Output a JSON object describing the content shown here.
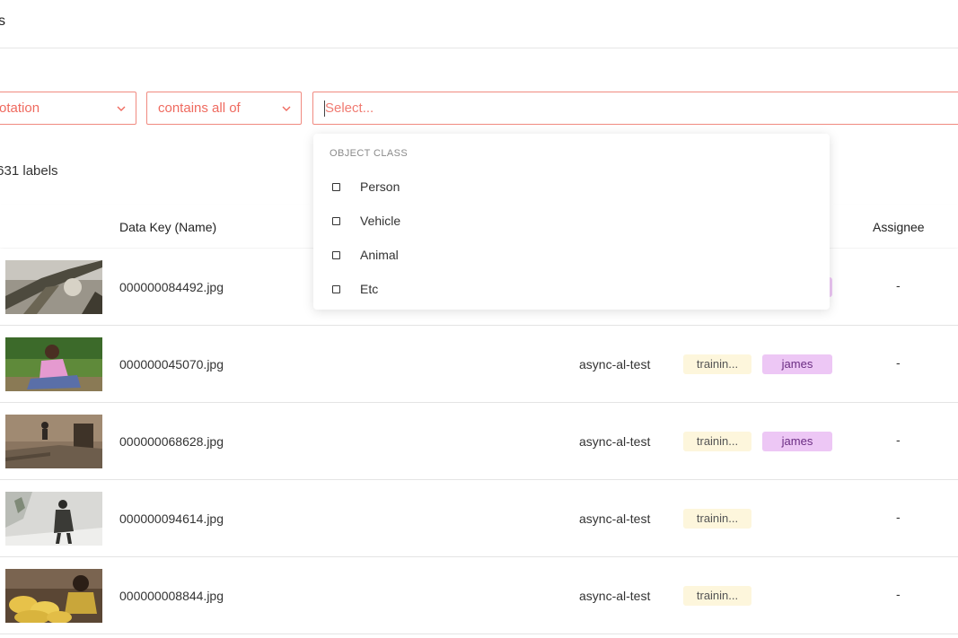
{
  "header": {
    "title": "s"
  },
  "filters": {
    "field": "otation",
    "operator": "contains all of",
    "value_placeholder": "Select..."
  },
  "summary": {
    "count": ",631 labels"
  },
  "table": {
    "headers": {
      "data_key": "Data Key (Name)",
      "assignee": "Assignee"
    },
    "rows": [
      {
        "key": "000000084492.jpg",
        "project": "",
        "tag": "",
        "user": "",
        "assignee": "-"
      },
      {
        "key": "000000045070.jpg",
        "project": "async-al-test",
        "tag": "trainin...",
        "user": "james",
        "assignee": "-"
      },
      {
        "key": "000000068628.jpg",
        "project": "async-al-test",
        "tag": "trainin...",
        "user": "james",
        "assignee": "-"
      },
      {
        "key": "000000094614.jpg",
        "project": "async-al-test",
        "tag": "trainin...",
        "user": "",
        "assignee": "-"
      },
      {
        "key": "000000008844.jpg",
        "project": "async-al-test",
        "tag": "trainin...",
        "user": "",
        "assignee": "-"
      }
    ]
  },
  "dropdown": {
    "section_label": "OBJECT CLASS",
    "options": [
      "Person",
      "Vehicle",
      "Animal",
      "Etc"
    ]
  },
  "colors": {
    "accent": "#ef6a5f",
    "tag_training_bg": "#fdf6dc",
    "tag_user_bg": "#edc7f5"
  },
  "icons": {
    "chevron": "chevron-down-icon",
    "checkbox": "checkbox-icon"
  }
}
